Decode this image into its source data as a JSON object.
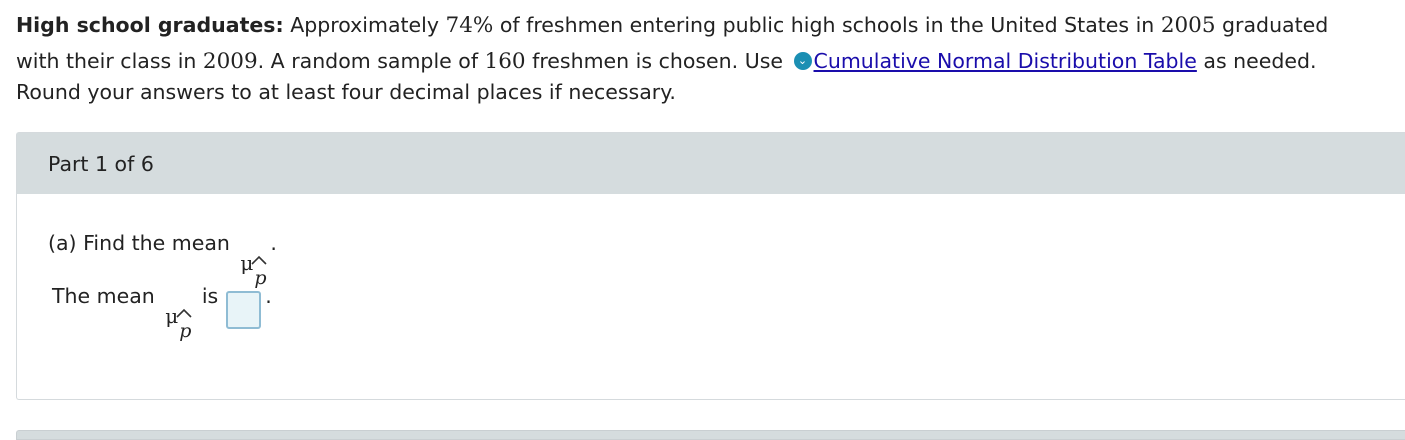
{
  "problem": {
    "title": "High school graduates:",
    "seg1": " Approximately ",
    "pct": "74%",
    "seg2": " of freshmen entering public high schools in the United States in ",
    "year1": "2005",
    "seg3": " graduated",
    "seg4": "with their class in ",
    "year2": "2009",
    "seg5": ". A random sample of ",
    "sample": "160",
    "seg6": " freshmen is chosen. Use ",
    "table_icon": "chevron-down-circle-icon",
    "table_link": "Cumulative Normal Distribution Table",
    "seg7": " as needed.",
    "line3": "Round your answers to at least four decimal places if necessary."
  },
  "part": {
    "title": "Part 1 of 6",
    "question_prefix": "(a) Find the mean ",
    "question_suffix": ".",
    "answer_prefix": "The mean ",
    "answer_is": " is",
    "answer_suffix": ".",
    "answer_value": "",
    "mu_symbol": "μ",
    "subscript": "p"
  },
  "colors": {
    "header_bg": "#d5dcde",
    "link": "#1a0dab",
    "icon": "#1b8fb3",
    "input_bg": "#e8f4f8",
    "input_border": "#8fbcd4"
  }
}
